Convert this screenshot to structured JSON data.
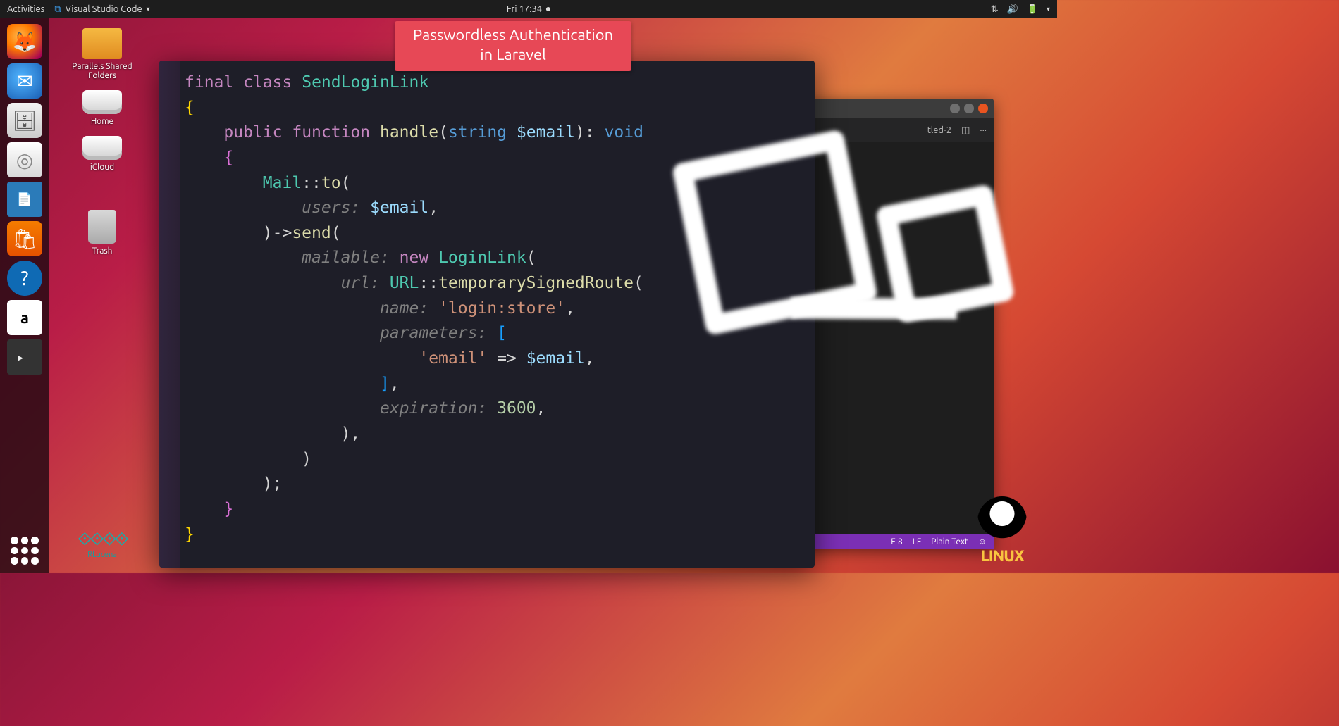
{
  "topbar": {
    "activities": "Activities",
    "app_name": "Visual Studio Code",
    "clock": "Fri 17:34"
  },
  "desktop_icons": [
    {
      "label": "Parallels Shared Folders",
      "kind": "folder"
    },
    {
      "label": "Home",
      "kind": "drive"
    },
    {
      "label": "iCloud",
      "kind": "drive"
    },
    {
      "label": "Trash",
      "kind": "trash"
    }
  ],
  "banner": {
    "line1": "Passwordless Authentication",
    "line2": "in Laravel"
  },
  "vscode_back": {
    "tab_label": "tled-2",
    "status": {
      "encoding": "F-8",
      "eol": "LF",
      "lang": "Plain Text"
    }
  },
  "code": {
    "keywords": {
      "final": "final",
      "class": "class",
      "public": "public",
      "function": "function",
      "new": "new",
      "void": "void",
      "string": "string"
    },
    "class_name": "SendLoginLink",
    "fn_handle": "handle",
    "var_email": "$email",
    "mail": "Mail",
    "to": "to",
    "users_param": "users:",
    "send": "send",
    "mailable_param": "mailable:",
    "login_link": "LoginLink",
    "url_param": "url:",
    "url_class": "URL",
    "tsr": "temporarySignedRoute",
    "name_param": "name:",
    "name_val": "'login:store'",
    "params_param": "parameters:",
    "email_key": "'email'",
    "arrow": "=>",
    "expiration_param": "expiration:",
    "expiration_val": "3600"
  },
  "linux_label": "LINUX",
  "dna_label": "RLucena"
}
